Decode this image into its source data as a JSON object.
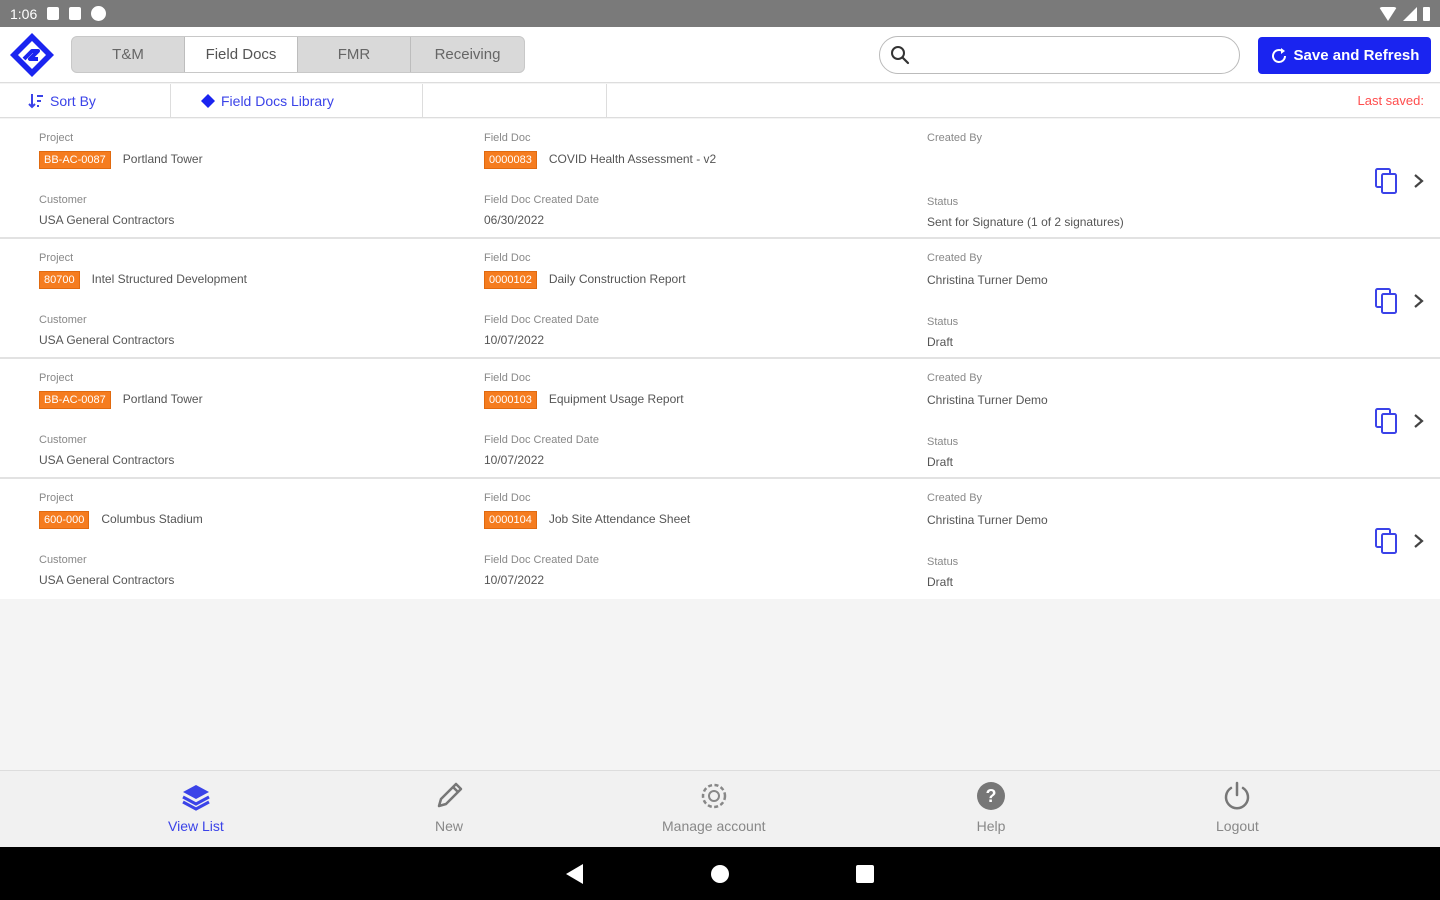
{
  "status_bar": {
    "time": "1:06"
  },
  "tabs": [
    {
      "label": "T&M",
      "active": false
    },
    {
      "label": "Field Docs",
      "active": true
    },
    {
      "label": "FMR",
      "active": false
    },
    {
      "label": "Receiving",
      "active": false
    }
  ],
  "search": {
    "value": "",
    "placeholder": ""
  },
  "save_button": {
    "label": "Save and Refresh"
  },
  "toolbar": {
    "sort_label": "Sort By",
    "library_label": "Field Docs Library",
    "last_saved": "Last saved:"
  },
  "rows": [
    {
      "project_label": "Project",
      "project_code": "BB-AC-0087",
      "project_name": "Portland Tower",
      "customer_label": "Customer",
      "customer": "USA General Contractors",
      "fielddoc_label": "Field Doc",
      "fielddoc_code": "0000083",
      "fielddoc_name": "COVID Health Assessment - v2",
      "created_date_label": "Field Doc Created Date",
      "created_date": "06/30/2022",
      "created_by_label": "Created By",
      "created_by": "",
      "status_label": "Status",
      "status": "Sent for Signature (1 of 2 signatures)"
    },
    {
      "project_label": "Project",
      "project_code": "80700",
      "project_name": "Intel Structured Development",
      "customer_label": "Customer",
      "customer": "USA General Contractors",
      "fielddoc_label": "Field Doc",
      "fielddoc_code": "0000102",
      "fielddoc_name": "Daily Construction Report",
      "created_date_label": "Field Doc Created Date",
      "created_date": "10/07/2022",
      "created_by_label": "Created By",
      "created_by": "Christina Turner Demo",
      "status_label": "Status",
      "status": "Draft"
    },
    {
      "project_label": "Project",
      "project_code": "BB-AC-0087",
      "project_name": "Portland Tower",
      "customer_label": "Customer",
      "customer": "USA General Contractors",
      "fielddoc_label": "Field Doc",
      "fielddoc_code": "0000103",
      "fielddoc_name": "Equipment Usage Report",
      "created_date_label": "Field Doc Created Date",
      "created_date": "10/07/2022",
      "created_by_label": "Created By",
      "created_by": "Christina Turner Demo",
      "status_label": "Status",
      "status": "Draft"
    },
    {
      "project_label": "Project",
      "project_code": "600-000",
      "project_name": "Columbus Stadium",
      "customer_label": "Customer",
      "customer": "USA General Contractors",
      "fielddoc_label": "Field Doc",
      "fielddoc_code": "0000104",
      "fielddoc_name": "Job Site Attendance Sheet",
      "created_date_label": "Field Doc Created Date",
      "created_date": "10/07/2022",
      "created_by_label": "Created By",
      "created_by": "Christina Turner Demo",
      "status_label": "Status",
      "status": "Draft"
    }
  ],
  "bottom_nav": {
    "view_list": "View List",
    "new": "New",
    "manage_account": "Manage account",
    "help": "Help",
    "logout": "Logout"
  },
  "colors": {
    "accent": "#1a24f0",
    "badge": "#f57c1f",
    "link": "#3b43e8",
    "last_saved": "#ff4d4d"
  }
}
